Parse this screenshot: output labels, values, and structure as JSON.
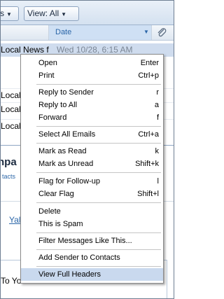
{
  "toolbar": {
    "left_button_label": "s",
    "view_button_label": "View: All"
  },
  "columns": {
    "date_label": "Date"
  },
  "email_rows": [
    {
      "subject": "Local News f",
      "date": "Wed 10/28, 6:15 AM"
    },
    {
      "subject": "Local",
      "date": ""
    },
    {
      "subject": "Local",
      "date": ""
    },
    {
      "subject": "Local",
      "date": ""
    }
  ],
  "preview": {
    "title": "npa",
    "contacts_link": "tacts",
    "ya_link": "Yal",
    "body_text": "To Your Mailbox."
  },
  "menu": {
    "items": [
      {
        "label": "Open",
        "shortcut": "Enter"
      },
      {
        "label": "Print",
        "shortcut": "Ctrl+p"
      },
      {
        "label": "Reply to Sender",
        "shortcut": "r"
      },
      {
        "label": "Reply to All",
        "shortcut": "a"
      },
      {
        "label": "Forward",
        "shortcut": "f"
      },
      {
        "label": "Select All Emails",
        "shortcut": "Ctrl+a"
      },
      {
        "label": "Mark as Read",
        "shortcut": "k"
      },
      {
        "label": "Mark as Unread",
        "shortcut": "Shift+k"
      },
      {
        "label": "Flag for Follow-up",
        "shortcut": "l"
      },
      {
        "label": "Clear Flag",
        "shortcut": "Shift+l"
      },
      {
        "label": "Delete",
        "shortcut": ""
      },
      {
        "label": "This is Spam",
        "shortcut": ""
      },
      {
        "label": "Filter Messages Like This...",
        "shortcut": ""
      },
      {
        "label": "Add Sender to Contacts",
        "shortcut": ""
      },
      {
        "label": "View Full Headers",
        "shortcut": ""
      }
    ]
  },
  "colors": {
    "highlight": "#c9d9ee",
    "link": "#2b66a8",
    "toolbar_bg": "#d4e1f0"
  }
}
